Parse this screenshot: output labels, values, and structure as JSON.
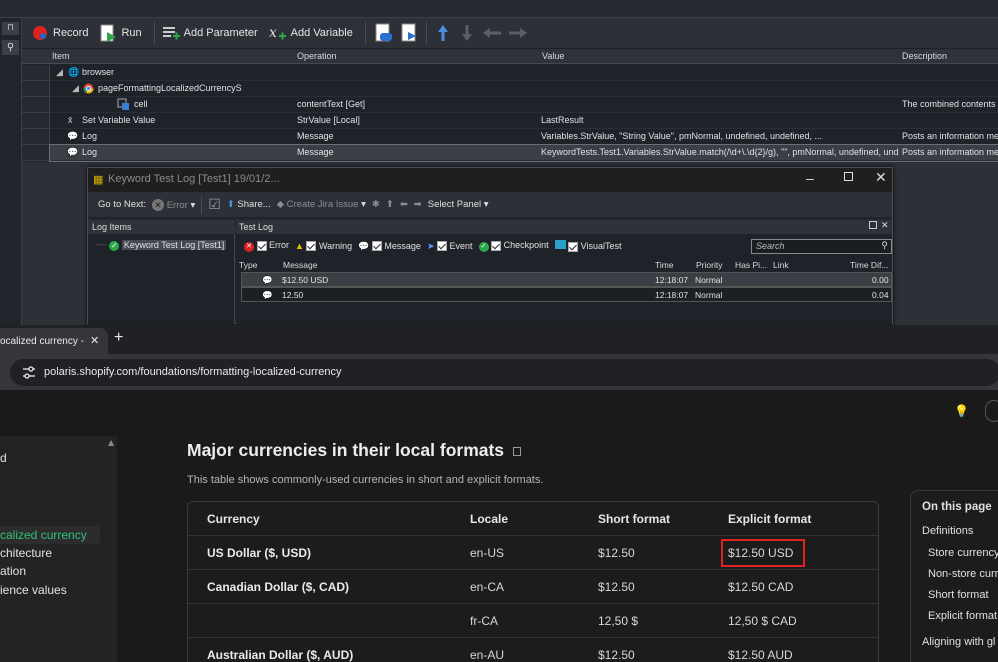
{
  "ide": {
    "toolbar": {
      "record": "Record",
      "run": "Run",
      "add_parameter": "Add Parameter",
      "add_variable": "Add Variable"
    },
    "grid": {
      "columns": [
        "Item",
        "Operation",
        "Value",
        "Description"
      ],
      "rows": [
        {
          "item": "browser",
          "operation": "",
          "value": "",
          "description": ""
        },
        {
          "item": "pageFormattingLocalizedCurrencyS",
          "operation": "",
          "value": "",
          "description": ""
        },
        {
          "item": "cell",
          "operation": "contentText [Get]",
          "value": "",
          "description": "The combined contents of"
        },
        {
          "item": "Set Variable Value",
          "operation": "StrValue [Local]",
          "value": "LastResult",
          "description": ""
        },
        {
          "item": "Log",
          "operation": "Message",
          "value": "Variables.StrValue, \"String Value\", pmNormal, undefined, undefined, ...",
          "description": "Posts an information mess"
        },
        {
          "item": "Log",
          "operation": "Message",
          "value": "KeywordTests.Test1.Variables.StrValue.match(/\\d+\\.\\d{2}/g), \"\", pmNormal, undefined, und",
          "description": "Posts an information mess"
        }
      ]
    }
  },
  "log_window": {
    "title": "Keyword Test Log [Test1] 19/01/2...",
    "toolbar": {
      "go_to_next": "Go to Next:",
      "error": "Error",
      "share": "Share...",
      "create_jira": "Create Jira Issue",
      "select_panel": "Select Panel"
    },
    "log_items": {
      "header": "Log Items",
      "item": "Keyword Test Log [Test1]"
    },
    "test_log": {
      "header": "Test Log",
      "filters": [
        "Error",
        "Warning",
        "Message",
        "Event",
        "Checkpoint",
        "VisualTest"
      ],
      "search_placeholder": "Search",
      "columns": [
        "Type",
        "Message",
        "Time",
        "Priority",
        "Has Pi...",
        "Link",
        "Time Dif..."
      ],
      "rows": [
        {
          "message": "$12.50 USD",
          "time": "12:18:07",
          "priority": "Normal",
          "time_diff": "0.00"
        },
        {
          "message": "12.50",
          "time": "12:18:07",
          "priority": "Normal",
          "time_diff": "0.04"
        }
      ]
    }
  },
  "browser": {
    "tab_title": "ocalized currency -",
    "new_tab": "+",
    "url": "polaris.shopify.com/foundations/formatting-localized-currency",
    "sidenav": [
      "d",
      "calized currency",
      "chitecture",
      "ation",
      "ience values"
    ],
    "heading": "Major currencies in their local formats",
    "subheading": "This table shows commonly-used currencies in short and explicit formats.",
    "table": {
      "columns": [
        "Currency",
        "Locale",
        "Short format",
        "Explicit format"
      ],
      "rows": [
        {
          "currency": "US Dollar ($, USD)",
          "locale": "en-US",
          "short": "$12.50",
          "explicit": "$12.50 USD"
        },
        {
          "currency": "Canadian Dollar ($, CAD)",
          "locale": "en-CA",
          "short": "$12.50",
          "explicit": "$12.50 CAD"
        },
        {
          "currency": "",
          "locale": "fr-CA",
          "short": "12,50 $",
          "explicit": "12,50 $ CAD"
        },
        {
          "currency": "Australian Dollar ($, AUD)",
          "locale": "en-AU",
          "short": "$12.50",
          "explicit": "$12.50 AUD"
        }
      ]
    },
    "on_this_page": {
      "title": "On this page",
      "items": [
        "Definitions",
        "Store currency",
        "Non-store curr",
        "Short format",
        "Explicit format",
        "Aligning with gl"
      ]
    }
  },
  "colors": {
    "highlight": "#e02424",
    "accent_green": "#2ec27e"
  }
}
